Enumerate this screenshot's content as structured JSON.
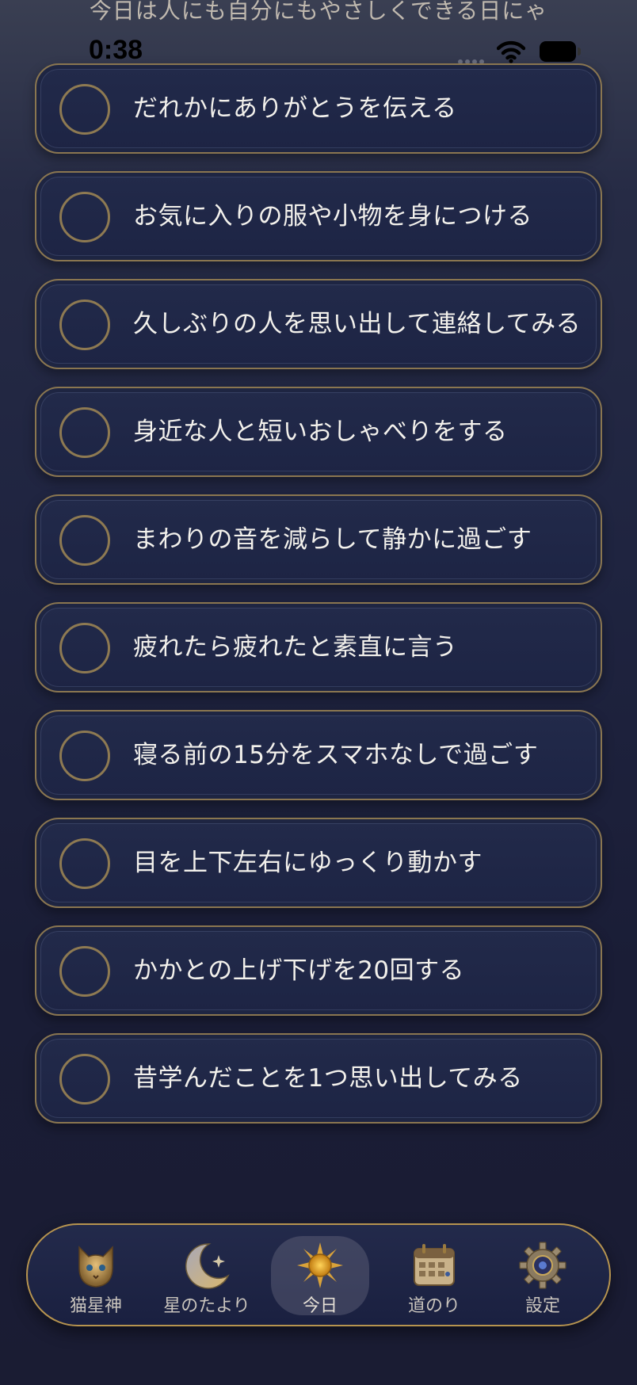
{
  "header": {
    "message": "今日は人にも自分にもやさしくできる日にゃ"
  },
  "status_bar": {
    "time": "0:38"
  },
  "tasks": [
    {
      "label": "だれかにありがとうを伝える",
      "done": false
    },
    {
      "label": "お気に入りの服や小物を身につける",
      "done": false
    },
    {
      "label": "久しぶりの人を思い出して連絡してみる",
      "done": false
    },
    {
      "label": "身近な人と短いおしゃべりをする",
      "done": false
    },
    {
      "label": "まわりの音を減らして静かに過ごす",
      "done": false
    },
    {
      "label": "疲れたら疲れたと素直に言う",
      "done": false
    },
    {
      "label": "寝る前の15分をスマホなしで過ごす",
      "done": false
    },
    {
      "label": "目を上下左右にゆっくり動かす",
      "done": false
    },
    {
      "label": "かかとの上げ下げを20回する",
      "done": false
    },
    {
      "label": "昔学んだことを1つ思い出してみる",
      "done": false
    }
  ],
  "tab_bar": {
    "items": [
      {
        "label": "猫星神",
        "icon": "cat-icon"
      },
      {
        "label": "星のたより",
        "icon": "crescent-moon-icon"
      },
      {
        "label": "今日",
        "icon": "sun-icon",
        "active": true
      },
      {
        "label": "道のり",
        "icon": "calendar-icon"
      },
      {
        "label": "設定",
        "icon": "gear-icon"
      }
    ]
  },
  "colors": {
    "card_border": "#8a7650",
    "tab_border": "#b7944f",
    "background": "#1f2440"
  }
}
